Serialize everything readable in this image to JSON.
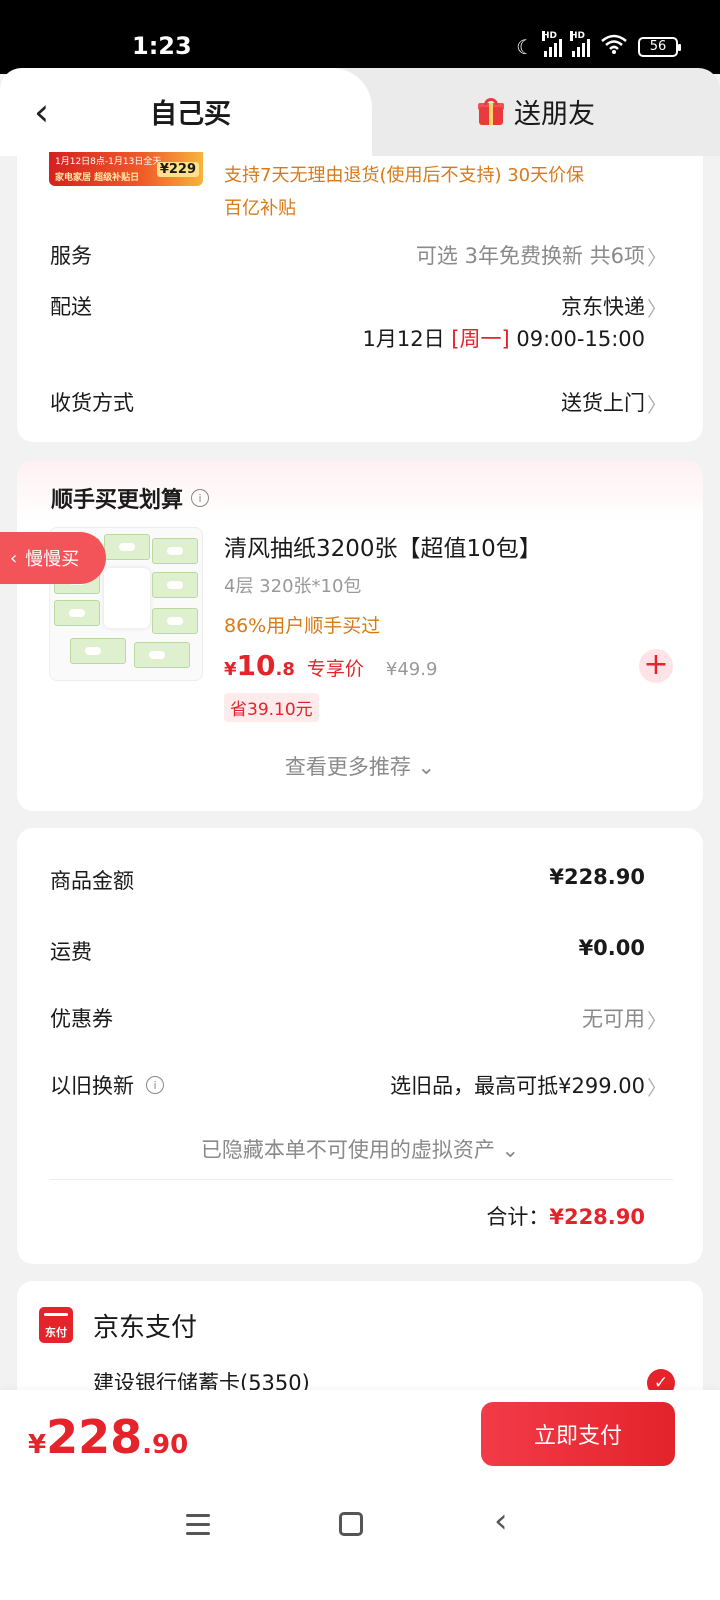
{
  "status_bar": {
    "time": "1:23",
    "battery": "56",
    "hd1": "HD",
    "hd2": "HD"
  },
  "header": {
    "tab_self": "自己买",
    "tab_gift": "送朋友"
  },
  "promo": {
    "banner_line1": "1月12日8点-1月13日全天",
    "banner_line2": "家电家居 超级补贴日",
    "banner_price": "¥229",
    "support_text": "支持7天无理由退货(使用后不支持) 30天价保",
    "subsidy_text": "百亿补贴"
  },
  "rows": {
    "service_label": "服务",
    "service_value": "可选 3年免费换新 共6项",
    "delivery_label": "配送",
    "delivery_value": "京东快递",
    "delivery_date": "1月12日",
    "delivery_weekday": "[周一]",
    "delivery_time": "09:00-15:00",
    "receive_label": "收货方式",
    "receive_value": "送货上门"
  },
  "slow_buy": "慢慢买",
  "recommend": {
    "title": "顺手买更划算",
    "product_name": "清风抽纸3200张【超值10包】",
    "spec": "4层 320张*10包",
    "rate": "86%用户顺手买过",
    "price_yen": "¥",
    "price_int": "10",
    "price_dec": ".8",
    "price_tag": "专享价",
    "orig_price": "¥49.9",
    "save": "省39.10元",
    "more": "查看更多推荐 ⌄"
  },
  "summary": {
    "goods_label": "商品金额",
    "goods_value": "¥228.90",
    "shipping_label": "运费",
    "shipping_value": "¥0.00",
    "coupon_label": "优惠券",
    "coupon_value": "无可用",
    "tradein_label": "以旧换新",
    "tradein_value": "选旧品，最高可抵¥299.00",
    "hidden_assets": "已隐藏本单不可使用的虚拟资产 ⌄",
    "total_label": "合计：",
    "total_value": "¥228.90"
  },
  "payment": {
    "icon_text": "东付",
    "title": "京东支付",
    "bank": "建设银行储蓄卡(5350)"
  },
  "paybar": {
    "yen": "¥",
    "int": "228",
    "dec": ".90",
    "button": "立即支付"
  },
  "colors": {
    "accent": "#e4232b",
    "orange": "#d97a17",
    "gray_text": "#999999"
  }
}
